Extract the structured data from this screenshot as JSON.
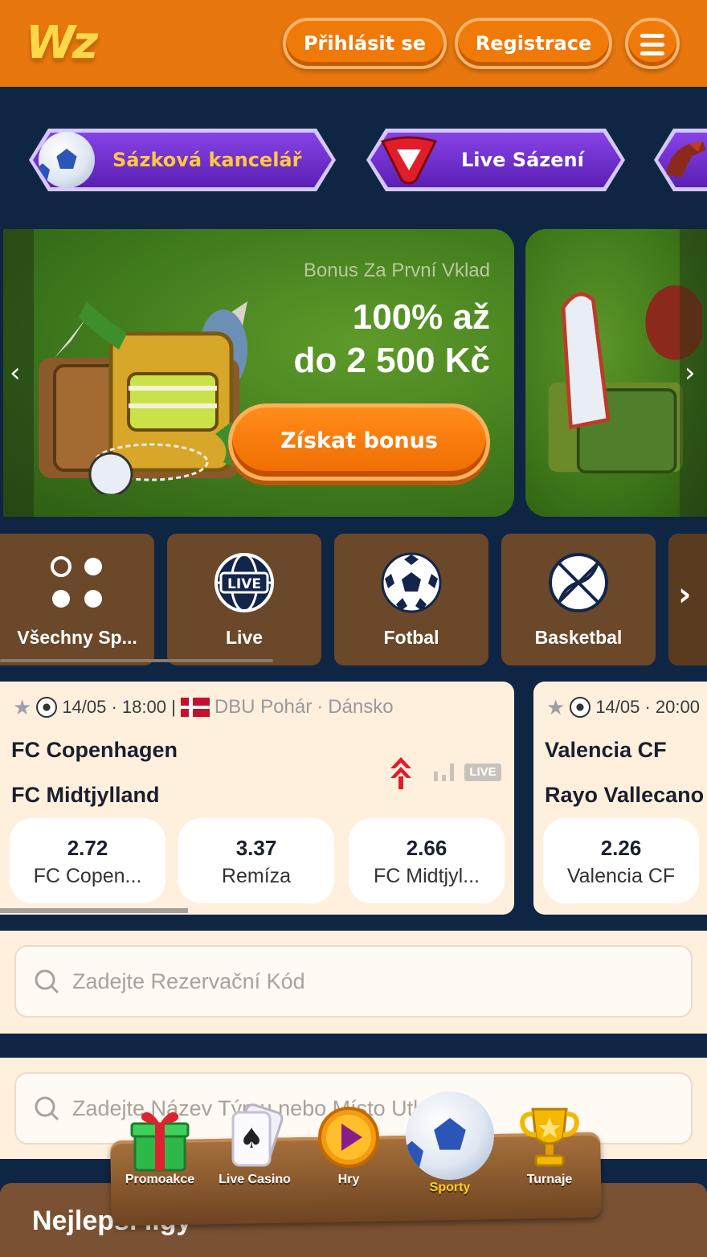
{
  "header": {
    "logo_text": "Wz",
    "login_label": "Přihlásit se",
    "register_label": "Registrace"
  },
  "top_nav": {
    "items": [
      {
        "label": "Sázková kancelář",
        "icon": "soccer-ball-icon"
      },
      {
        "label": "Live Sázení",
        "icon": "live-play-icon"
      }
    ]
  },
  "banner": {
    "subtitle": "Bonus Za První Vklad",
    "title_line1": "100% až",
    "title_line2": "do 2 500 Kč",
    "cta_label": "Získat bonus"
  },
  "sport_categories": [
    {
      "label": "Všechny Sp...",
      "icon": "four-dots-icon"
    },
    {
      "label": "Live",
      "icon": "live-globe-icon"
    },
    {
      "label": "Fotbal",
      "icon": "soccer-ball-icon"
    },
    {
      "label": "Basketbal",
      "icon": "basketball-icon"
    }
  ],
  "matches": [
    {
      "datetime": "14/05 · 18:00 |",
      "league": "DBU Pohár",
      "country": "Dánsko",
      "home": "FC Copenhagen",
      "away": "FC Midtjylland",
      "live_badge": "LIVE",
      "odds": [
        {
          "value": "2.72",
          "label": "FC Copen..."
        },
        {
          "value": "3.37",
          "label": "Remíza"
        },
        {
          "value": "2.66",
          "label": "FC Midtjyl..."
        }
      ]
    },
    {
      "datetime": "14/05 · 20:00",
      "home": "Valencia CF",
      "away": "Rayo Vallecano",
      "odds": [
        {
          "value": "2.26",
          "label": "Valencia CF"
        }
      ]
    }
  ],
  "booking_search": {
    "placeholder": "Zadejte Rezervační Kód"
  },
  "team_search": {
    "placeholder": "Zadejte Název Týmu nebo Místo Utkání"
  },
  "best_leagues_title": "Nejlepší ligy",
  "bottom_nav": [
    {
      "label": "Promoakce",
      "icon": "gift-icon"
    },
    {
      "label": "Live Casino",
      "icon": "cards-icon"
    },
    {
      "label": "Hry",
      "icon": "play-icon"
    },
    {
      "label": "Sporty",
      "icon": "soccer-ball-icon",
      "active": true
    },
    {
      "label": "Turnaje",
      "icon": "trophy-icon"
    }
  ],
  "colors": {
    "header_bg": "#e8780e",
    "page_bg": "#0f2544",
    "accent_purple": "#6a2fd0",
    "card_bg": "#fff0de",
    "category_bg": "#6b4829",
    "active_nav": "#ffd21a"
  }
}
